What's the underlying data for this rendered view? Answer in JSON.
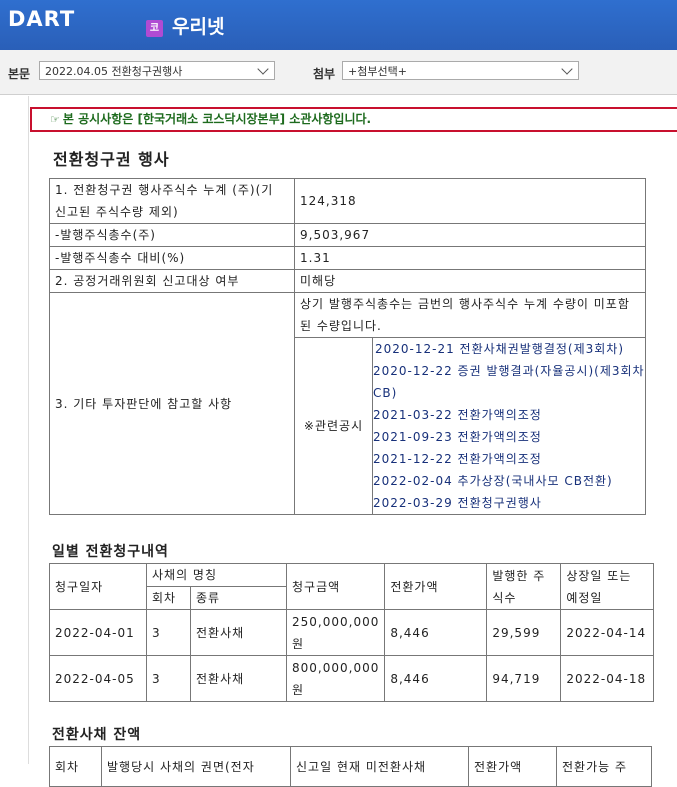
{
  "header": {
    "logo": "DART",
    "brand_icon": "코",
    "brand": "우리넷"
  },
  "selectbar": {
    "doc_label": "본문",
    "doc_value": "2022.04.05  전환청구권행사",
    "attach_label": "첨부",
    "attach_value": "+첨부선택+"
  },
  "notice": "본 공시사항은 [한국거래소 코스닥시장본부] 소관사항입니다.",
  "title": "전환청구권 행사",
  "summary": {
    "r1_label": "1. 전환청구권 행사주식수 누계 (주)(기 신고된 주식수량 제외)",
    "r1_value": "124,318",
    "r2_label": "-발행주식총수(주)",
    "r2_value": "9,503,967",
    "r3_label": "-발행주식총수 대비(%)",
    "r3_value": "1.31",
    "r4_label": "2. 공정거래위원회 신고대상 여부",
    "r4_value": "미해당",
    "r5_label": "3. 기타 투자판단에 참고할 사항",
    "r5_note": "상기 발행주식총수는 금번의 행사주식수 누계 수량이 미포함된 수량입니다.",
    "related_label": "※관련공시",
    "related": [
      "2020-12-21 전환사채권발행결정(제3회차)",
      "2020-12-22 증권 발행결과(자율공시)(제3회차 CB)",
      "2021-03-22 전환가액의조정",
      "2021-09-23 전환가액의조정",
      "2021-12-22 전환가액의조정",
      "2022-02-04 추가상장(국내사모 CB전환)",
      "2022-03-29 전환청구권행사"
    ]
  },
  "daily": {
    "title": "일별 전환청구내역",
    "headers": {
      "date": "청구일자",
      "bond_name": "사채의 명칭",
      "round": "회차",
      "kind": "종류",
      "amount": "청구금액",
      "price": "전환가액",
      "shares": "발행한 주식수",
      "listing": "상장일 또는 예정일"
    },
    "rows": [
      {
        "date": "2022-04-01",
        "round": "3",
        "kind": "전환사채",
        "amount": "250,000,000원",
        "price": "8,446",
        "shares": "29,599",
        "listing": "2022-04-14"
      },
      {
        "date": "2022-04-05",
        "round": "3",
        "kind": "전환사채",
        "amount": "800,000,000원",
        "price": "8,446",
        "shares": "94,719",
        "listing": "2022-04-18"
      }
    ]
  },
  "balance": {
    "title": "전환사채 잔액",
    "headers": [
      "회차",
      "발행당시 사채의 권면(전자",
      "신고일 현재 미전환사채",
      "전환가액",
      "전환가능 주"
    ]
  }
}
